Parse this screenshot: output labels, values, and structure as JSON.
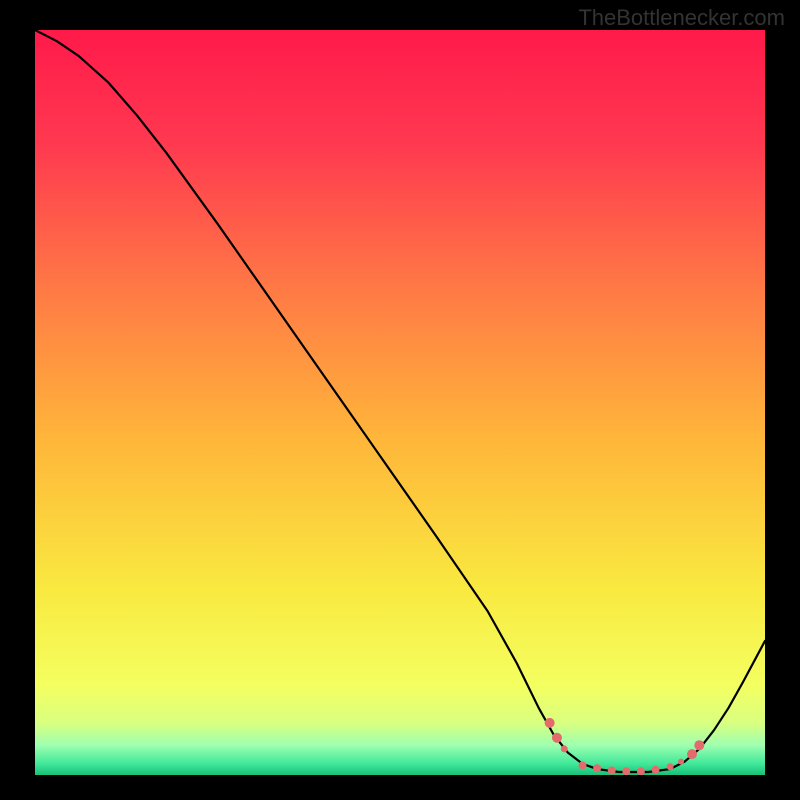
{
  "watermark": "TheBottlenecker.com",
  "chart_data": {
    "type": "line",
    "title": "",
    "xlabel": "",
    "ylabel": "",
    "x_range": [
      0,
      100
    ],
    "y_range": [
      0,
      100
    ],
    "series": [
      {
        "name": "curve",
        "stroke": "#000000",
        "stroke_width": 2.2,
        "points": [
          {
            "x": 0,
            "y": 100
          },
          {
            "x": 3,
            "y": 98.5
          },
          {
            "x": 6,
            "y": 96.5
          },
          {
            "x": 10,
            "y": 93
          },
          {
            "x": 14,
            "y": 88.5
          },
          {
            "x": 18,
            "y": 83.5
          },
          {
            "x": 25,
            "y": 74
          },
          {
            "x": 35,
            "y": 60
          },
          {
            "x": 45,
            "y": 46
          },
          {
            "x": 55,
            "y": 32
          },
          {
            "x": 62,
            "y": 22
          },
          {
            "x": 66,
            "y": 15
          },
          {
            "x": 69,
            "y": 9
          },
          {
            "x": 71,
            "y": 5.5
          },
          {
            "x": 73,
            "y": 3
          },
          {
            "x": 75,
            "y": 1.5
          },
          {
            "x": 77,
            "y": 0.8
          },
          {
            "x": 80,
            "y": 0.4
          },
          {
            "x": 84,
            "y": 0.4
          },
          {
            "x": 87,
            "y": 0.8
          },
          {
            "x": 89,
            "y": 1.8
          },
          {
            "x": 91,
            "y": 3.5
          },
          {
            "x": 93,
            "y": 6
          },
          {
            "x": 95,
            "y": 9
          },
          {
            "x": 97,
            "y": 12.5
          },
          {
            "x": 100,
            "y": 18
          }
        ]
      }
    ],
    "markers": [
      {
        "x": 70.5,
        "y": 7,
        "r": 5
      },
      {
        "x": 71.5,
        "y": 5,
        "r": 5
      },
      {
        "x": 72.5,
        "y": 3.5,
        "r": 3.5
      },
      {
        "x": 75,
        "y": 1.3,
        "r": 4
      },
      {
        "x": 77,
        "y": 0.9,
        "r": 4
      },
      {
        "x": 79,
        "y": 0.6,
        "r": 4
      },
      {
        "x": 81,
        "y": 0.5,
        "r": 4
      },
      {
        "x": 83,
        "y": 0.5,
        "r": 4
      },
      {
        "x": 85,
        "y": 0.7,
        "r": 4
      },
      {
        "x": 87,
        "y": 1.1,
        "r": 3.5
      },
      {
        "x": 88.5,
        "y": 1.8,
        "r": 3
      },
      {
        "x": 90,
        "y": 2.8,
        "r": 5
      },
      {
        "x": 91,
        "y": 4,
        "r": 5
      }
    ],
    "marker_color": "#e46b6b",
    "gradient_stops": [
      {
        "offset": 0,
        "color": "#ff1a4a"
      },
      {
        "offset": 0.15,
        "color": "#ff3850"
      },
      {
        "offset": 0.35,
        "color": "#ff7a45"
      },
      {
        "offset": 0.55,
        "color": "#ffb63a"
      },
      {
        "offset": 0.75,
        "color": "#f9e940"
      },
      {
        "offset": 0.88,
        "color": "#f4ff60"
      },
      {
        "offset": 0.93,
        "color": "#d9ff80"
      },
      {
        "offset": 0.96,
        "color": "#9fffb0"
      },
      {
        "offset": 0.985,
        "color": "#40e89a"
      },
      {
        "offset": 1,
        "color": "#18c078"
      }
    ]
  }
}
